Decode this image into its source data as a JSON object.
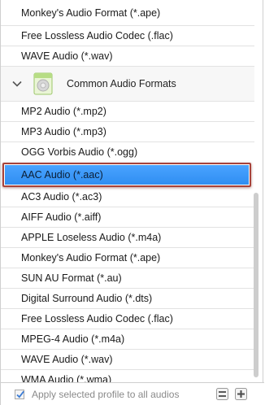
{
  "list": {
    "top_items": [
      {
        "label": "Monkey's Audio Format (*.ape)"
      },
      {
        "label": "Free Lossless Audio Codec (.flac)"
      },
      {
        "label": "WAVE Audio (*.wav)"
      }
    ],
    "group": {
      "label": "Common Audio Formats",
      "icon": "audio-format-icon",
      "expand_icon": "chevron-down-icon"
    },
    "items_before": [
      {
        "label": "MP2 Audio (*.mp2)"
      },
      {
        "label": "MP3 Audio (*.mp3)"
      },
      {
        "label": "OGG Vorbis Audio (*.ogg)"
      }
    ],
    "selected": {
      "label": "AAC Audio (*.aac)"
    },
    "items_after": [
      {
        "label": "AC3 Audio (*.ac3)"
      },
      {
        "label": "AIFF Audio (*.aiff)"
      },
      {
        "label": "APPLE Loseless Audio (*.m4a)"
      },
      {
        "label": "Monkey's Audio Format (*.ape)"
      },
      {
        "label": "SUN AU Format (*.au)"
      },
      {
        "label": "Digital Surround Audio (*.dts)"
      },
      {
        "label": "Free Lossless Audio Codec (.flac)"
      },
      {
        "label": "MPEG-4 Audio (*.m4a)"
      },
      {
        "label": "WAVE Audio (*.wav)"
      },
      {
        "label": "WMA Audio (*.wma)"
      }
    ]
  },
  "footer": {
    "checkbox_label": "Apply selected profile to all audios",
    "checked": true,
    "buttons": [
      {
        "icon": "collapse-all-icon"
      },
      {
        "icon": "add-icon"
      }
    ]
  },
  "colors": {
    "selection": "#3a97f7",
    "highlight_border": "#a7423a"
  }
}
